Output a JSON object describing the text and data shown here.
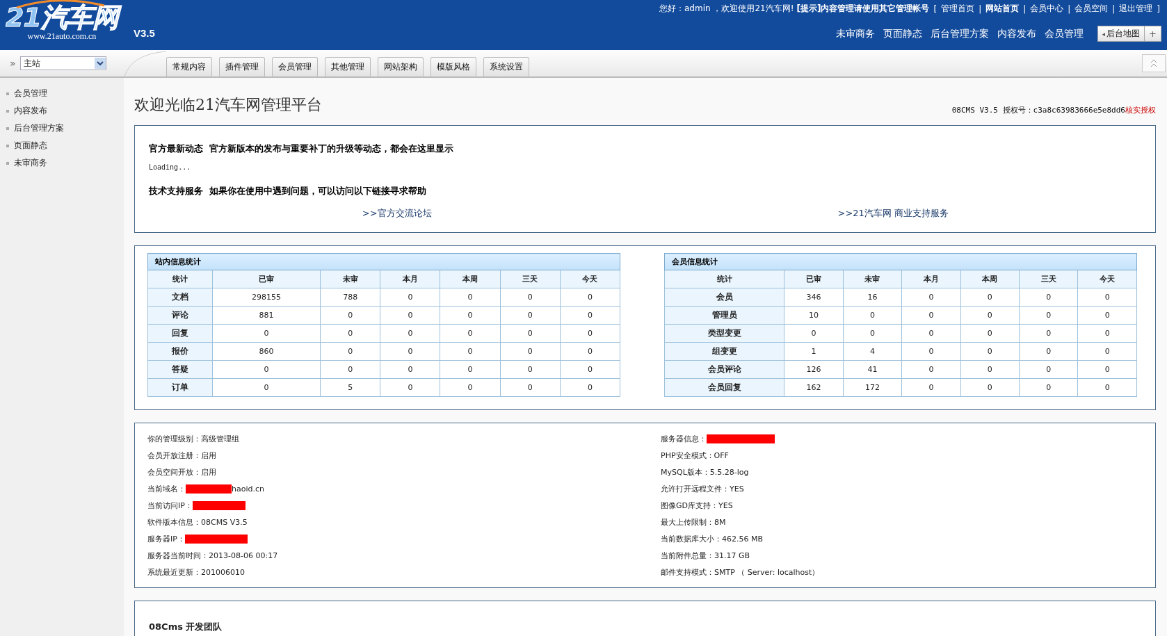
{
  "header": {
    "logo": {
      "name": "21汽车网",
      "url": "www.21auto.com.cn"
    },
    "version": "V3.5",
    "greeting": "您好：admin ，欢迎使用21汽车网!",
    "notice": "[提示]内容管理请使用其它管理帐号",
    "links": [
      {
        "kind": "bracket",
        "text": "["
      },
      {
        "kind": "link",
        "text": "管理首页",
        "bold": false
      },
      {
        "kind": "separator",
        "text": "|"
      },
      {
        "kind": "link",
        "text": "网站首页",
        "bold": true
      },
      {
        "kind": "separator",
        "text": "|"
      },
      {
        "kind": "link",
        "text": "会员中心",
        "bold": false
      },
      {
        "kind": "separator",
        "text": "|"
      },
      {
        "kind": "link",
        "text": "会员空间",
        "bold": false
      },
      {
        "kind": "separator",
        "text": "|"
      },
      {
        "kind": "link",
        "text": "退出管理",
        "bold": false
      },
      {
        "kind": "bracket",
        "text": "]"
      }
    ],
    "quick_nav": [
      "未审商务",
      "页面静态",
      "后台管理方案",
      "内容发布",
      "会员管理"
    ],
    "map_button": {
      "arrow": "◂",
      "label": "后台地图"
    },
    "add_button": "+"
  },
  "toolbar": {
    "expand": "»",
    "site_select": {
      "value": "主站"
    },
    "tabs": [
      {
        "label": "常规内容",
        "selected": false
      },
      {
        "label": "插件管理",
        "selected": false
      },
      {
        "label": "会员管理",
        "selected": false
      },
      {
        "label": "其他管理",
        "selected": false
      },
      {
        "label": "网站架构",
        "selected": false
      },
      {
        "label": "模版风格",
        "selected": false
      },
      {
        "label": "系统设置",
        "selected": false
      }
    ]
  },
  "sidebar": {
    "items": [
      "会员管理",
      "内容发布",
      "后台管理方案",
      "页面静态",
      "未审商务"
    ]
  },
  "page_title": "欢迎光临21汽车网管理平台",
  "license": {
    "text": "08CMS V3.5 授权号：c3a8c63983666e5e8dd6",
    "link": "核实授权"
  },
  "news": {
    "title": "官方最新动态",
    "desc": "官方新版本的发布与重要补丁的升级等动态，都会在这里显示",
    "loading": "Loading...",
    "support_title": "技术支持服务",
    "support_desc": "如果你在使用中遇到问题，可以访问以下链接寻求帮助",
    "support_links": [
      ">>官方交流论坛",
      ">>21汽车网 商业支持服务"
    ]
  },
  "stats": [
    {
      "title": "站内信息统计",
      "columns": [
        "统计",
        "已审",
        "未审",
        "本月",
        "本周",
        "三天",
        "今天"
      ],
      "rows": [
        [
          "文档",
          "298155",
          "788",
          "0",
          "0",
          "0",
          "0"
        ],
        [
          "评论",
          "881",
          "0",
          "0",
          "0",
          "0",
          "0"
        ],
        [
          "回复",
          "0",
          "0",
          "0",
          "0",
          "0",
          "0"
        ],
        [
          "报价",
          "860",
          "0",
          "0",
          "0",
          "0",
          "0"
        ],
        [
          "答疑",
          "0",
          "0",
          "0",
          "0",
          "0",
          "0"
        ],
        [
          "订单",
          "0",
          "5",
          "0",
          "0",
          "0",
          "0"
        ]
      ]
    },
    {
      "title": "会员信息统计",
      "columns": [
        "统计",
        "已审",
        "未审",
        "本月",
        "本周",
        "三天",
        "今天"
      ],
      "rows": [
        [
          "会员",
          "346",
          "16",
          "0",
          "0",
          "0",
          "0"
        ],
        [
          "管理员",
          "10",
          "0",
          "0",
          "0",
          "0",
          "0"
        ],
        [
          "类型变更",
          "0",
          "0",
          "0",
          "0",
          "0",
          "0"
        ],
        [
          "组变更",
          "1",
          "4",
          "0",
          "0",
          "0",
          "0"
        ],
        [
          "会员评论",
          "126",
          "41",
          "0",
          "0",
          "0",
          "0"
        ],
        [
          "会员回复",
          "162",
          "172",
          "0",
          "0",
          "0",
          "0"
        ]
      ]
    }
  ],
  "system_info": [
    [
      {
        "label": "你的管理级别：",
        "value": "高级管理组",
        "redacted": false
      },
      {
        "label": "会员开放注册：",
        "value": "启用",
        "redacted": false
      },
      {
        "label": "会员空间开放：",
        "value": "启用",
        "redacted": false
      },
      {
        "label": "当前域名：",
        "value": "haoid.cn",
        "redacted": true
      },
      {
        "label": "当前访问IP：",
        "redacted": true
      },
      {
        "label": "软件版本信息：",
        "value": "08CMS V3.5",
        "redacted": false
      },
      {
        "label": "服务器IP：",
        "redacted": true
      },
      {
        "label": "服务器当前时间：",
        "value": "2013-08-06 00:17",
        "redacted": false
      },
      {
        "label": "系统最近更新：",
        "value": "201006010",
        "redacted": false
      }
    ],
    [
      {
        "label": "服务器信息：",
        "redacted": true
      },
      {
        "label": "PHP安全模式：",
        "value": "OFF",
        "redacted": false
      },
      {
        "label": "MySQL版本：",
        "value": "5.5.28-log",
        "redacted": false
      },
      {
        "label": "允许打开远程文件：",
        "value": "YES",
        "redacted": false
      },
      {
        "label": "图像GD库支持：",
        "value": "YES",
        "redacted": false
      },
      {
        "label": "最大上传限制：",
        "value": "8M",
        "redacted": false
      },
      {
        "label": "当前数据库大小：",
        "value": "462.56 MB",
        "redacted": false
      },
      {
        "label": "当前附件总量：",
        "value": "31.17 GB",
        "redacted": false
      },
      {
        "label": "邮件支持模式：",
        "value": "SMTP （ Server: localhost）",
        "redacted": false
      }
    ]
  ],
  "team": {
    "title": "08Cms 开发团队"
  }
}
